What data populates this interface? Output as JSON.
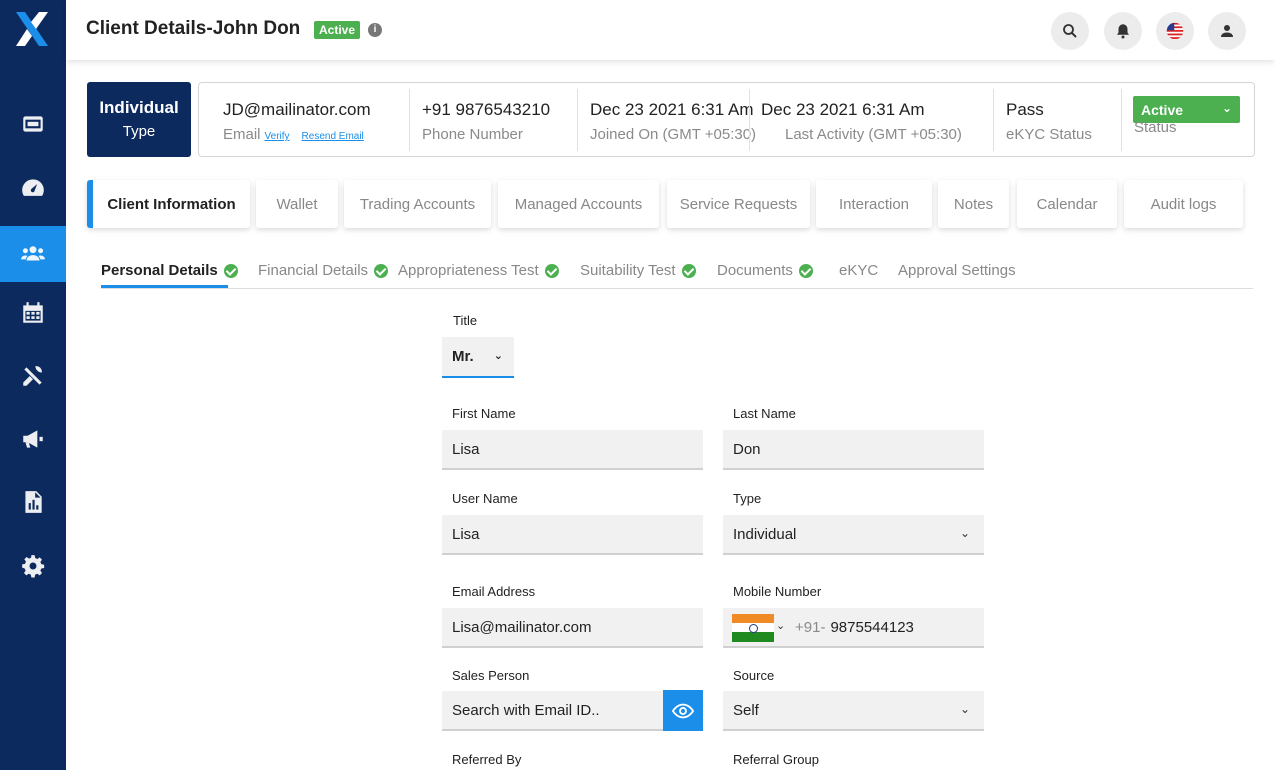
{
  "header": {
    "title": "Client Details-John Don",
    "badge": "Active"
  },
  "sidebar": {
    "items": [
      {
        "icon": "accounts-icon"
      },
      {
        "icon": "dashboard-icon"
      },
      {
        "icon": "users-icon",
        "active": true
      },
      {
        "icon": "calendar-icon"
      },
      {
        "icon": "tools-icon"
      },
      {
        "icon": "megaphone-icon"
      },
      {
        "icon": "report-icon"
      },
      {
        "icon": "settings-icon"
      }
    ]
  },
  "summary": {
    "type_value": "Individual",
    "type_label": "Type",
    "email_value": "JD@mailinator.com",
    "email_label": "Email",
    "verify_link": "Verify",
    "resend_link": "Resend Email",
    "phone_value": "+91 9876543210",
    "phone_label": "Phone Number",
    "joined_value": "Dec 23 2021 6:31 Am",
    "joined_label": "Joined On (GMT +05:30)",
    "activity_value": "Dec 23 2021 6:31 Am",
    "activity_label": "Last Activity (GMT +05:30)",
    "ekyc_value": "Pass",
    "ekyc_label": "eKYC Status",
    "status_value": "Active",
    "status_label": "Status"
  },
  "tabs": [
    {
      "label": "Client Information",
      "active": true
    },
    {
      "label": "Wallet"
    },
    {
      "label": "Trading Accounts"
    },
    {
      "label": "Managed Accounts"
    },
    {
      "label": "Service Requests"
    },
    {
      "label": "Interaction"
    },
    {
      "label": "Notes"
    },
    {
      "label": "Calendar"
    },
    {
      "label": "Audit logs"
    }
  ],
  "subtabs": [
    {
      "label": "Personal Details",
      "checked": true,
      "active": true
    },
    {
      "label": "Financial Details",
      "checked": true
    },
    {
      "label": "Appropriateness Test",
      "checked": true
    },
    {
      "label": "Suitability Test",
      "checked": true
    },
    {
      "label": "Documents",
      "checked": true
    },
    {
      "label": "eKYC"
    },
    {
      "label": "Approval Settings"
    }
  ],
  "form": {
    "title_label": "Title",
    "title_value": "Mr.",
    "first_name_label": "First Name",
    "first_name_value": "Lisa",
    "last_name_label": "Last Name",
    "last_name_value": "Don",
    "username_label": "User Name",
    "username_value": "Lisa",
    "type_label": "Type",
    "type_value": "Individual",
    "email_label": "Email Address",
    "email_value": "Lisa@mailinator.com",
    "mobile_label": "Mobile Number",
    "mobile_prefix": "+91-",
    "mobile_value": "9875544123",
    "sales_label": "Sales Person",
    "sales_placeholder": "Search with Email ID..",
    "source_label": "Source",
    "source_value": "Self",
    "referred_label": "Referred By",
    "referral_group_label": "Referral Group"
  }
}
